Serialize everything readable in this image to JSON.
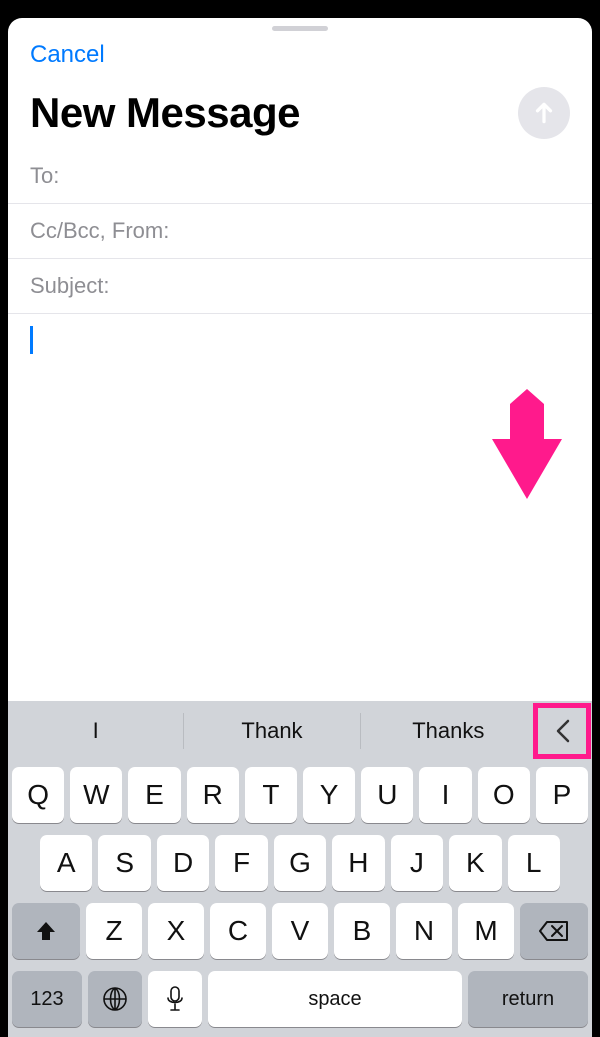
{
  "header": {
    "cancel": "Cancel",
    "title": "New Message"
  },
  "fields": {
    "to_label": "To:",
    "to_value": "",
    "cc_label": "Cc/Bcc, From:",
    "cc_value": "",
    "subject_label": "Subject:",
    "subject_value": ""
  },
  "body_value": "",
  "suggestions": [
    "I",
    "Thank",
    "Thanks"
  ],
  "keyboard": {
    "row1": [
      "Q",
      "W",
      "E",
      "R",
      "T",
      "Y",
      "U",
      "I",
      "O",
      "P"
    ],
    "row2": [
      "A",
      "S",
      "D",
      "F",
      "G",
      "H",
      "J",
      "K",
      "L"
    ],
    "row3": [
      "Z",
      "X",
      "C",
      "V",
      "B",
      "N",
      "M"
    ],
    "numKey": "123",
    "spaceKey": "space",
    "returnKey": "return"
  },
  "annotation": {
    "arrow_color": "#ff1a8c"
  }
}
